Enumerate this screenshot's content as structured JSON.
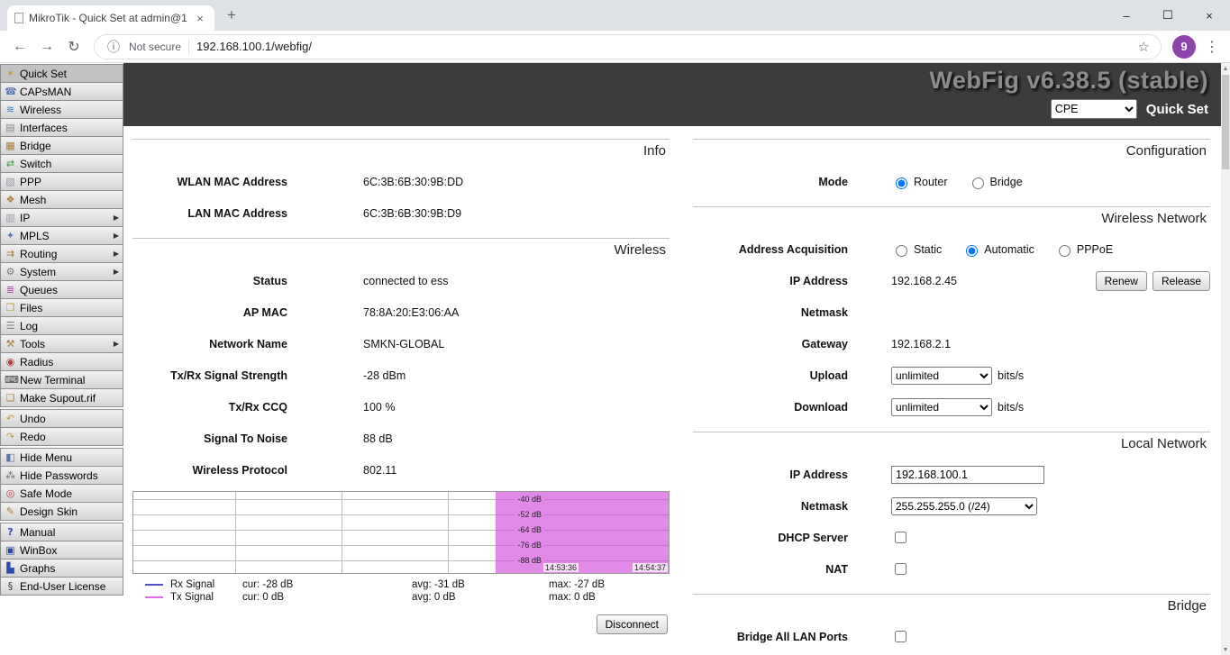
{
  "browser": {
    "tab_title": "MikroTik - Quick Set at admin@1",
    "security_label": "Not secure",
    "url": "192.168.100.1/webfig/",
    "avatar_badge": "9"
  },
  "icons": {
    "back": "←",
    "forward": "→",
    "reload": "↻",
    "info": "ⓘ",
    "star": "☆",
    "menu": "⋮",
    "minimize": "–",
    "maximize": "☐",
    "close": "×",
    "tab_close": "×",
    "new_tab": "+",
    "scroll_up": "▲",
    "scroll_down": "▼"
  },
  "header": {
    "webfig_title": "WebFig v6.38.5 (stable)",
    "mode_value": "CPE",
    "page_title": "Quick Set"
  },
  "sidebar": {
    "items": [
      {
        "label": "Quick Set",
        "glyph": "✶",
        "color": "#c49a3c"
      },
      {
        "label": "CAPsMAN",
        "glyph": "☎",
        "color": "#5a79b4"
      },
      {
        "label": "Wireless",
        "glyph": "≋",
        "color": "#3c7ec4"
      },
      {
        "label": "Interfaces",
        "glyph": "▤",
        "color": "#8a8a8a"
      },
      {
        "label": "Bridge",
        "glyph": "▦",
        "color": "#a87c3c"
      },
      {
        "label": "Switch",
        "glyph": "⇄",
        "color": "#3c9a3c"
      },
      {
        "label": "PPP",
        "glyph": "▧",
        "color": "#9a9aa8"
      },
      {
        "label": "Mesh",
        "glyph": "❖",
        "color": "#a87c3c"
      },
      {
        "label": "IP",
        "glyph": "▥",
        "color": "#9a9aa8",
        "arrow": "▶"
      },
      {
        "label": "MPLS",
        "glyph": "✦",
        "color": "#5a79b4",
        "arrow": "▶"
      },
      {
        "label": "Routing",
        "glyph": "⇉",
        "color": "#a87c3c",
        "arrow": "▶"
      },
      {
        "label": "System",
        "glyph": "⚙",
        "color": "#7a7a7a",
        "arrow": "▶"
      },
      {
        "label": "Queues",
        "glyph": "≣",
        "color": "#a03ca0"
      },
      {
        "label": "Files",
        "glyph": "❐",
        "color": "#b4a03c"
      },
      {
        "label": "Log",
        "glyph": "☰",
        "color": "#7a7a7a"
      },
      {
        "label": "Tools",
        "glyph": "⚒",
        "color": "#a87c3c",
        "arrow": "▶"
      },
      {
        "label": "Radius",
        "glyph": "◉",
        "color": "#b43c3c"
      },
      {
        "label": "New Terminal",
        "glyph": "⌨",
        "color": "#3c3c3c"
      },
      {
        "label": "Make Supout.rif",
        "glyph": "❏",
        "color": "#a87c3c"
      },
      {
        "label": "Undo",
        "glyph": "↶",
        "color": "#c49a3c"
      },
      {
        "label": "Redo",
        "glyph": "↷",
        "color": "#c49a3c"
      },
      {
        "label": "Hide Menu",
        "glyph": "◧",
        "color": "#5a79b4"
      },
      {
        "label": "Hide Passwords",
        "glyph": "⁂",
        "color": "#6a6a6a"
      },
      {
        "label": "Safe Mode",
        "glyph": "◎",
        "color": "#b43c3c"
      },
      {
        "label": "Design Skin",
        "glyph": "✎",
        "color": "#a87c3c"
      },
      {
        "label": "Manual",
        "glyph": "?",
        "color": "#2a4ab0"
      },
      {
        "label": "WinBox",
        "glyph": "▣",
        "color": "#2a4ab0"
      },
      {
        "label": "Graphs",
        "glyph": "▙",
        "color": "#2a4ab0"
      },
      {
        "label": "End-User License",
        "glyph": "§",
        "color": "#3c3c3c"
      }
    ]
  },
  "left": {
    "info": {
      "title": "Info",
      "rows": [
        {
          "label": "WLAN MAC Address",
          "value": "6C:3B:6B:30:9B:DD"
        },
        {
          "label": "LAN MAC Address",
          "value": "6C:3B:6B:30:9B:D9"
        }
      ]
    },
    "wireless": {
      "title": "Wireless",
      "rows": [
        {
          "label": "Status",
          "value": "connected to ess"
        },
        {
          "label": "AP MAC",
          "value": "78:8A:20:E3:06:AA"
        },
        {
          "label": "Network Name",
          "value": "SMKN-GLOBAL"
        },
        {
          "label": "Tx/Rx Signal Strength",
          "value": "-28 dBm"
        },
        {
          "label": "Tx/Rx CCQ",
          "value": "100 %"
        },
        {
          "label": "Signal To Noise",
          "value": "88 dB"
        },
        {
          "label": "Wireless Protocol",
          "value": "802.11"
        }
      ]
    },
    "chart": {
      "y_labels": [
        "-40 dB",
        "-52 dB",
        "-64 dB",
        "-76 dB",
        "-88 dB"
      ],
      "time_start": "14:53:36",
      "time_end": "14:54:37",
      "fill_color": "#e18ae8",
      "legend": [
        {
          "name": "Rx Signal",
          "line_color": "#5050c8",
          "cur": "cur: -28 dB",
          "avg": "avg: -31 dB",
          "max": "max: -27 dB"
        },
        {
          "name": "Tx Signal",
          "line_color": "#e06ae0",
          "cur": "cur: 0 dB",
          "avg": "avg: 0 dB",
          "max": "max: 0 dB"
        }
      ]
    },
    "disconnect_label": "Disconnect"
  },
  "right": {
    "configuration": {
      "title": "Configuration",
      "mode": {
        "label": "Mode",
        "options": [
          {
            "label": "Router",
            "selected": true
          },
          {
            "label": "Bridge",
            "selected": false
          }
        ]
      }
    },
    "wireless_network": {
      "title": "Wireless Network",
      "address_acquisition": {
        "label": "Address Acquisition",
        "options": [
          {
            "label": "Static",
            "selected": false
          },
          {
            "label": "Automatic",
            "selected": true
          },
          {
            "label": "PPPoE",
            "selected": false
          }
        ]
      },
      "ip_address": {
        "label": "IP Address",
        "value": "192.168.2.45",
        "renew_label": "Renew",
        "release_label": "Release"
      },
      "netmask": {
        "label": "Netmask",
        "value": ""
      },
      "gateway": {
        "label": "Gateway",
        "value": "192.168.2.1"
      },
      "upload": {
        "label": "Upload",
        "value": "unlimited",
        "unit": "bits/s"
      },
      "download": {
        "label": "Download",
        "value": "unlimited",
        "unit": "bits/s"
      }
    },
    "local_network": {
      "title": "Local Network",
      "ip_address": {
        "label": "IP Address",
        "value": "192.168.100.1"
      },
      "netmask": {
        "label": "Netmask",
        "value": "255.255.255.0 (/24)"
      },
      "dhcp_server": {
        "label": "DHCP Server",
        "checked": false
      },
      "nat": {
        "label": "NAT",
        "checked": false
      }
    },
    "bridge": {
      "title": "Bridge",
      "bridge_all_lan_ports": {
        "label": "Bridge All LAN Ports",
        "checked": false
      }
    }
  }
}
